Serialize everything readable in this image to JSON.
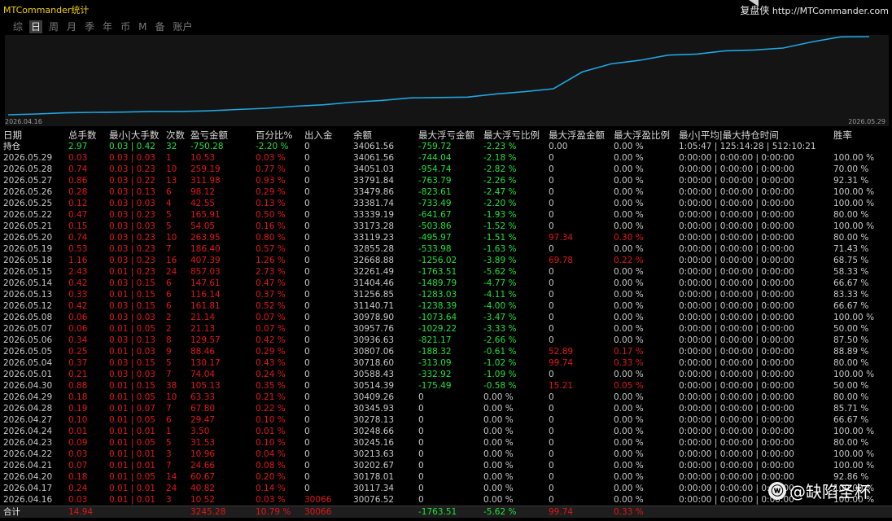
{
  "app": {
    "title": "MTCommander统计",
    "brand_cn": "复盘侠",
    "brand_url": "http://MTCommander.com"
  },
  "tabs": [
    "综",
    "日",
    "周",
    "月",
    "季",
    "年",
    "币",
    "M",
    "备",
    "账户"
  ],
  "active_tab": 1,
  "chart": {
    "start_label": "2026.04.16",
    "end_label": "2026.05.29",
    "line_color": "#1ea7e0"
  },
  "chart_data": {
    "type": "line",
    "x": [
      "2026.04.16",
      "2026.04.17",
      "2026.04.20",
      "2026.04.21",
      "2026.04.22",
      "2026.04.23",
      "2026.04.24",
      "2026.04.27",
      "2026.04.28",
      "2026.04.29",
      "2026.04.30",
      "2026.05.01",
      "2026.05.04",
      "2026.05.05",
      "2026.05.06",
      "2026.05.07",
      "2026.05.08",
      "2026.05.12",
      "2026.05.13",
      "2026.05.14",
      "2026.05.15",
      "2026.05.18",
      "2026.05.19",
      "2026.05.20",
      "2026.05.21",
      "2026.05.22",
      "2026.05.25",
      "2026.05.26",
      "2026.05.27",
      "2026.05.28",
      "2026.05.29"
    ],
    "values": [
      30076.52,
      30117.34,
      30178.01,
      30202.67,
      30213.63,
      30245.16,
      30248.66,
      30278.13,
      30345.93,
      30409.26,
      30514.39,
      30588.43,
      30718.6,
      30807.06,
      30936.63,
      30957.76,
      30978.9,
      31140.71,
      31256.85,
      31404.46,
      32261.49,
      32668.88,
      32855.28,
      33119.23,
      33173.28,
      33339.19,
      33381.74,
      33479.86,
      33791.84,
      34051.03,
      34061.56
    ]
  },
  "table": {
    "headers": [
      "日期",
      "总手数",
      "最小|大手数",
      "次数",
      "盈亏金额",
      "百分比%",
      "出入金",
      "余额",
      "最大浮亏金额",
      "最大浮亏比例",
      "最大浮盈金额",
      "最大浮盈比例",
      "最小|平均|最大持仓时间",
      "胜率"
    ],
    "position_row": [
      "持仓",
      "2.97",
      "0.03 | 0.42",
      "32",
      "-750.28",
      "-2.20 %",
      "0",
      "34061.56",
      "-759.72",
      "-2.23 %",
      "0.00",
      "0.00 %",
      "1:05:47 | 125:14:28 | 512:10:21",
      ""
    ],
    "rows": [
      [
        "2026.05.29",
        "0.03",
        "0.03 | 0.03",
        "1",
        "10.53",
        "0.03 %",
        "0",
        "34061.56",
        "-744.04",
        "-2.18 %",
        "0",
        "0.00 %",
        "0:00:00 | 0:00:00 | 0:00:00",
        "100.00 %"
      ],
      [
        "2026.05.28",
        "0.74",
        "0.03 | 0.23",
        "10",
        "259.19",
        "0.77 %",
        "0",
        "34051.03",
        "-954.74",
        "-2.82 %",
        "0",
        "0.00 %",
        "0:00:00 | 0:00:00 | 0:00:00",
        "70.00 %"
      ],
      [
        "2026.05.27",
        "0.86",
        "0.03 | 0.22",
        "13",
        "311.98",
        "0.93 %",
        "0",
        "33791.84",
        "-763.79",
        "-2.26 %",
        "0",
        "0.00 %",
        "0:00:00 | 0:00:00 | 0:00:00",
        "92.31 %"
      ],
      [
        "2026.05.26",
        "0.28",
        "0.03 | 0.13",
        "6",
        "98.12",
        "0.29 %",
        "0",
        "33479.86",
        "-823.61",
        "-2.47 %",
        "0",
        "0.00 %",
        "0:00:00 | 0:00:00 | 0:00:00",
        "100.00 %"
      ],
      [
        "2026.05.25",
        "0.12",
        "0.03 | 0.03",
        "4",
        "42.55",
        "0.13 %",
        "0",
        "33381.74",
        "-733.49",
        "-2.20 %",
        "0",
        "0.00 %",
        "0:00:00 | 0:00:00 | 0:00:00",
        "100.00 %"
      ],
      [
        "2026.05.22",
        "0.47",
        "0.03 | 0.23",
        "5",
        "165.91",
        "0.50 %",
        "0",
        "33339.19",
        "-641.67",
        "-1.93 %",
        "0",
        "0.00 %",
        "0:00:00 | 0:00:00 | 0:00:00",
        "80.00 %"
      ],
      [
        "2026.05.21",
        "0.15",
        "0.03 | 0.03",
        "5",
        "54.05",
        "0.16 %",
        "0",
        "33173.28",
        "-503.86",
        "-1.52 %",
        "0",
        "0.00 %",
        "0:00:00 | 0:00:00 | 0:00:00",
        "100.00 %"
      ],
      [
        "2026.05.20",
        "0.74",
        "0.03 | 0.23",
        "10",
        "263.95",
        "0.80 %",
        "0",
        "33119.23",
        "-495.97",
        "-1.51 %",
        "97.34",
        "0.30 %",
        "0:00:00 | 0:00:00 | 0:00:00",
        "80.00 %"
      ],
      [
        "2026.05.19",
        "0.53",
        "0.03 | 0.23",
        "7",
        "186.40",
        "0.57 %",
        "0",
        "32855.28",
        "-533.98",
        "-1.63 %",
        "0",
        "0.00 %",
        "0:00:00 | 0:00:00 | 0:00:00",
        "71.43 %"
      ],
      [
        "2026.05.18",
        "1.16",
        "0.03 | 0.23",
        "16",
        "407.39",
        "1.26 %",
        "0",
        "32668.88",
        "-1256.02",
        "-3.89 %",
        "69.78",
        "0.22 %",
        "0:00:00 | 0:00:00 | 0:00:00",
        "68.75 %"
      ],
      [
        "2026.05.15",
        "2.43",
        "0.01 | 0.23",
        "24",
        "857.03",
        "2.73 %",
        "0",
        "32261.49",
        "-1763.51",
        "-5.62 %",
        "0",
        "0.00 %",
        "0:00:00 | 0:00:00 | 0:00:00",
        "58.33 %"
      ],
      [
        "2026.05.14",
        "0.42",
        "0.03 | 0.15",
        "6",
        "147.61",
        "0.47 %",
        "0",
        "31404.46",
        "-1489.79",
        "-4.77 %",
        "0",
        "0.00 %",
        "0:00:00 | 0:00:00 | 0:00:00",
        "66.67 %"
      ],
      [
        "2026.05.13",
        "0.33",
        "0.01 | 0.15",
        "6",
        "116.14",
        "0.37 %",
        "0",
        "31256.85",
        "-1283.03",
        "-4.11 %",
        "0",
        "0.00 %",
        "0:00:00 | 0:00:00 | 0:00:00",
        "83.33 %"
      ],
      [
        "2026.05.12",
        "0.42",
        "0.03 | 0.15",
        "6",
        "161.81",
        "0.52 %",
        "0",
        "31140.71",
        "-1238.39",
        "-4.00 %",
        "0",
        "0.00 %",
        "0:00:00 | 0:00:00 | 0:00:00",
        "66.67 %"
      ],
      [
        "2026.05.08",
        "0.06",
        "0.03 | 0.03",
        "2",
        "21.14",
        "0.07 %",
        "0",
        "30978.90",
        "-1073.64",
        "-3.47 %",
        "0",
        "0.00 %",
        "0:00:00 | 0:00:00 | 0:00:00",
        "100.00 %"
      ],
      [
        "2026.05.07",
        "0.06",
        "0.01 | 0.05",
        "2",
        "21.13",
        "0.07 %",
        "0",
        "30957.76",
        "-1029.22",
        "-3.33 %",
        "0",
        "0.00 %",
        "0:00:00 | 0:00:00 | 0:00:00",
        "50.00 %"
      ],
      [
        "2026.05.06",
        "0.34",
        "0.03 | 0.13",
        "8",
        "129.57",
        "0.42 %",
        "0",
        "30936.63",
        "-821.17",
        "-2.66 %",
        "0",
        "0.00 %",
        "0:00:00 | 0:00:00 | 0:00:00",
        "87.50 %"
      ],
      [
        "2026.05.05",
        "0.25",
        "0.01 | 0.03",
        "9",
        "88.46",
        "0.29 %",
        "0",
        "30807.06",
        "-188.32",
        "-0.61 %",
        "52.89",
        "0.17 %",
        "0:00:00 | 0:00:00 | 0:00:00",
        "88.89 %"
      ],
      [
        "2026.05.04",
        "0.37",
        "0.03 | 0.15",
        "5",
        "130.17",
        "0.43 %",
        "0",
        "30718.60",
        "-313.09",
        "-1.02 %",
        "99.74",
        "0.33 %",
        "0:00:00 | 0:00:00 | 0:00:00",
        "80.00 %"
      ],
      [
        "2026.05.01",
        "0.21",
        "0.03 | 0.03",
        "7",
        "74.04",
        "0.24 %",
        "0",
        "30588.43",
        "-332.92",
        "-1.09 %",
        "0",
        "0.00 %",
        "0:00:00 | 0:00:00 | 0:00:00",
        "100.00 %"
      ],
      [
        "2026.04.30",
        "0.88",
        "0.01 | 0.15",
        "38",
        "105.13",
        "0.35 %",
        "0",
        "30514.39",
        "-175.49",
        "-0.58 %",
        "15.21",
        "0.05 %",
        "0:00:00 | 0:00:00 | 0:00:00",
        "50.00 %"
      ],
      [
        "2026.04.29",
        "0.18",
        "0.01 | 0.05",
        "10",
        "63.33",
        "0.21 %",
        "0",
        "30409.26",
        "0",
        "0.00 %",
        "0",
        "0.00 %",
        "0:00:00 | 0:00:00 | 0:00:00",
        "80.00 %"
      ],
      [
        "2026.04.28",
        "0.19",
        "0.01 | 0.07",
        "7",
        "67.80",
        "0.22 %",
        "0",
        "30345.93",
        "0",
        "0.00 %",
        "0",
        "0.00 %",
        "0:00:00 | 0:00:00 | 0:00:00",
        "85.71 %"
      ],
      [
        "2026.04.27",
        "0.10",
        "0.01 | 0.05",
        "6",
        "29.47",
        "0.10 %",
        "0",
        "30278.13",
        "0",
        "0.00 %",
        "0",
        "0.00 %",
        "0:00:00 | 0:00:00 | 0:00:00",
        "66.67 %"
      ],
      [
        "2026.04.24",
        "0.01",
        "0.01 | 0.01",
        "1",
        "3.50",
        "0.01 %",
        "0",
        "30248.66",
        "0",
        "0.00 %",
        "0",
        "0.00 %",
        "0:00:00 | 0:00:00 | 0:00:00",
        "100.00 %"
      ],
      [
        "2026.04.23",
        "0.09",
        "0.01 | 0.05",
        "5",
        "31.53",
        "0.10 %",
        "0",
        "30245.16",
        "0",
        "0.00 %",
        "0",
        "0.00 %",
        "0:00:00 | 0:00:00 | 0:00:00",
        "80.00 %"
      ],
      [
        "2026.04.22",
        "0.03",
        "0.01 | 0.01",
        "3",
        "10.96",
        "0.04 %",
        "0",
        "30213.63",
        "0",
        "0.00 %",
        "0",
        "0.00 %",
        "0:00:00 | 0:00:00 | 0:00:00",
        "100.00 %"
      ],
      [
        "2026.04.21",
        "0.07",
        "0.01 | 0.01",
        "7",
        "24.66",
        "0.08 %",
        "0",
        "30202.67",
        "0",
        "0.00 %",
        "0",
        "0.00 %",
        "0:00:00 | 0:00:00 | 0:00:00",
        "100.00 %"
      ],
      [
        "2026.04.20",
        "0.18",
        "0.01 | 0.05",
        "14",
        "60.67",
        "0.20 %",
        "0",
        "30178.01",
        "0",
        "0.00 %",
        "0",
        "0.00 %",
        "0:00:00 | 0:00:00 | 0:00:00",
        "92.86 %"
      ],
      [
        "2026.04.17",
        "0.24",
        "0.01 | 0.01",
        "24",
        "40.82",
        "0.14 %",
        "0",
        "30117.34",
        "0",
        "0.00 %",
        "0",
        "0.00 %",
        "0:00:00 | 0:00:00 | 0:00:00",
        "100.00 %"
      ],
      [
        "2026.04.16",
        "0.03",
        "0.01 | 0.01",
        "3",
        "10.52",
        "0.03 %",
        "30066",
        "30076.52",
        "0",
        "0.00 %",
        "0",
        "0.00 %",
        "0:00:00 | 0:00:00 | 0:00:00",
        "100.00 %"
      ]
    ],
    "summary_row": [
      "合计",
      "14.94",
      "",
      "",
      "3245.28",
      "10.79 %",
      "30066",
      "",
      "-1763.51",
      "-5.62 %",
      "99.74",
      "0.33 %",
      "",
      ""
    ]
  },
  "colors": {
    "profit": "#e01818",
    "loss": "#21e03c",
    "title": "#f2d000",
    "text": "#c8c8c8"
  },
  "watermark": {
    "icon": "weibo-logo-icon",
    "text": "@缺陷圣杯"
  }
}
